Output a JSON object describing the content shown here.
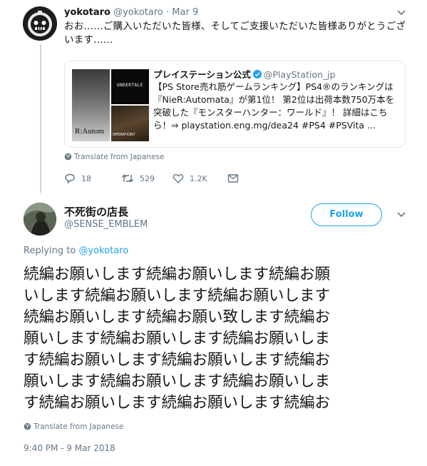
{
  "parent_tweet": {
    "name": "yokotaro",
    "handle": "@yokotaro",
    "separator": "·",
    "date": "Mar 9",
    "text": "おお……ご購入いただいた皆様、そしてご支援いただいた皆様ありがとうございます……",
    "quote": {
      "name": "プレイステーション公式",
      "handle": "@PlayStation_jp",
      "text": "【PS Store売れ筋ゲームランキング】PS4®のランキングは『NieR:Automata』が第1位！ 第2位は出荷本数750万本を突破した『モンスターハンター：ワールド』！ 詳細はこちら！⇒ playstation.eng.mg/dea24 #PS4 #PSVita ...",
      "image_labels": {
        "a": "R:Autom",
        "b": "UNDERTALE",
        "c": "OPERATION7"
      }
    },
    "translate_label": "Translate from Japanese",
    "actions": {
      "reply_count": "18",
      "retweet_count": "529",
      "like_count": "1.2K"
    }
  },
  "main_tweet": {
    "name": "不死街の店長",
    "handle": "@SENSE_EMBLEM",
    "follow_label": "Follow",
    "replying_prefix": "Replying to",
    "replying_handle": "@yokotaro",
    "text_lines": [
      "続編お願いします続編お願いします続編お願",
      "いします続編お願いします続編お願いします",
      "続編お願いします続編お願い致します続編お",
      "願いします続編お願いします続編お願いしま",
      "す続編お願いします続編お願いします続編お",
      "願いします続編お願いします続編お願いしま",
      "す続編お願いします続編お願いします続編お"
    ],
    "translate_label": "Translate from Japanese",
    "timestamp": "9:40 PM - 9 Mar 2018"
  },
  "colors": {
    "accent": "#1da1f2",
    "text": "#14171a",
    "muted": "#657786",
    "border": "#e1e8ed"
  },
  "icons": {
    "reply": "reply-icon",
    "retweet": "retweet-icon",
    "like": "heart-icon",
    "message": "envelope-icon",
    "translate": "globe-icon",
    "verified": "verified-badge-icon",
    "more": "chevron-down-icon"
  }
}
